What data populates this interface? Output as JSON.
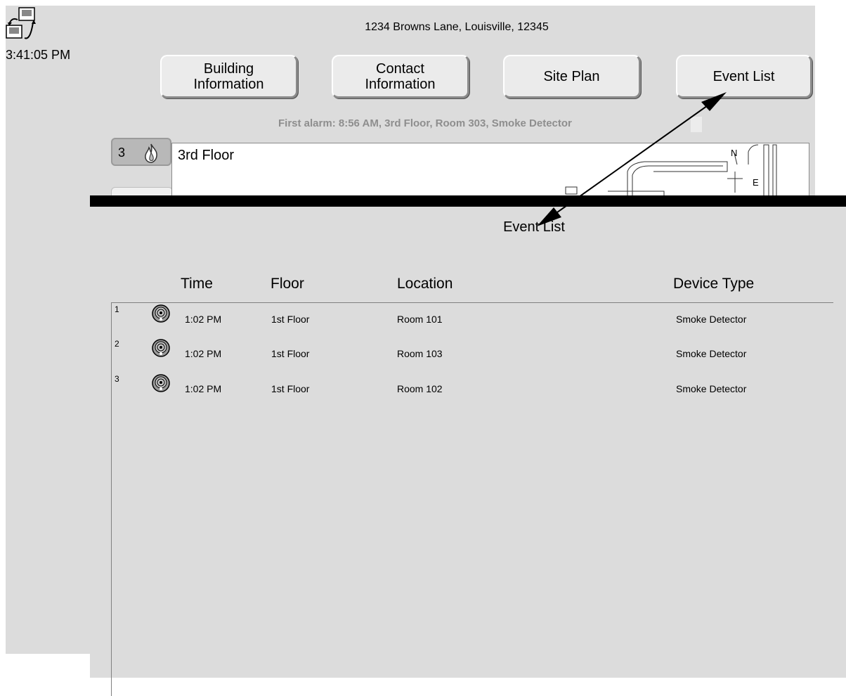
{
  "header": {
    "clock": "3:41:05 PM",
    "address": "1234 Browns Lane, Louisville, 12345",
    "network_icon": "network-computers-icon"
  },
  "nav": {
    "building_info": "Building\nInformation",
    "contact_info": "Contact\nInformation",
    "site_plan": "Site Plan",
    "event_list": "Event List"
  },
  "alarm": {
    "first_alarm": "First alarm: 8:56 AM,  3rd Floor,  Room 303,  Smoke Detector"
  },
  "floor": {
    "tab_number": "3",
    "tab_icon": "fire-icon",
    "name": "3rd Floor",
    "compass_n": "N",
    "compass_e": "E"
  },
  "dialog": {
    "title": "Event List",
    "columns": {
      "time": "Time",
      "floor": "Floor",
      "location": "Location",
      "device_type": "Device Type"
    },
    "rows": [
      {
        "index": "1",
        "icon": "smoke-detector-icon",
        "time": "1:02 PM",
        "floor": "1st Floor",
        "location": "Room 101",
        "device": "Smoke Detector"
      },
      {
        "index": "2",
        "icon": "smoke-detector-icon",
        "time": "1:02 PM",
        "floor": "1st Floor",
        "location": "Room 103",
        "device": "Smoke Detector"
      },
      {
        "index": "3",
        "icon": "smoke-detector-icon",
        "time": "1:02 PM",
        "floor": "1st Floor",
        "location": "Room 102",
        "device": "Smoke Detector"
      }
    ]
  },
  "colors": {
    "background": "#dcdcdc",
    "button_face": "#ebebeb",
    "alarm_text": "#8e8e8e",
    "title_bar": "#000000"
  }
}
